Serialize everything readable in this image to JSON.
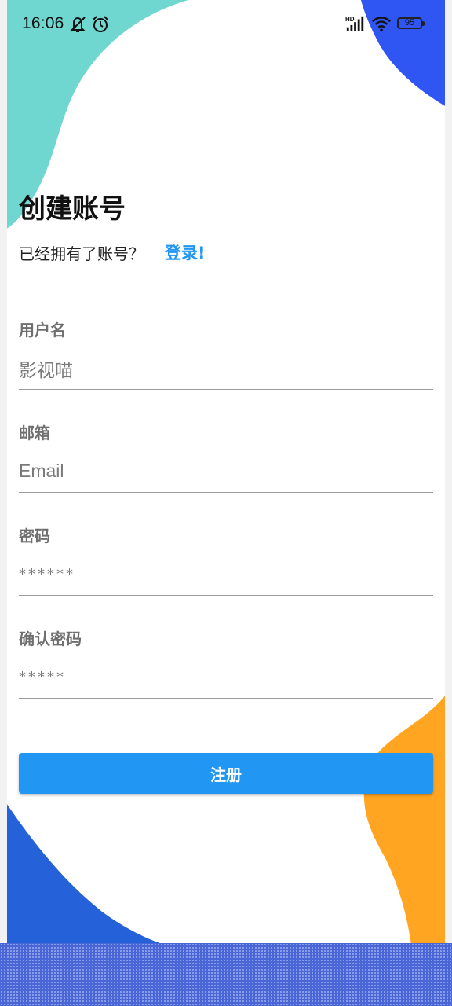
{
  "status_bar": {
    "time": "16:06",
    "network_badge": "HD",
    "battery": "95",
    "icons": [
      "mute-icon",
      "alarm-icon",
      "signal-icon",
      "wifi-icon",
      "battery-icon"
    ]
  },
  "header": {
    "title": "创建账号",
    "subtitle": "已经拥有了账号？",
    "login_link": "登录!"
  },
  "form": {
    "username": {
      "label": "用户名",
      "value": "影视喵"
    },
    "email": {
      "label": "邮箱",
      "placeholder": "Email"
    },
    "password": {
      "label": "密码",
      "value": "******"
    },
    "confirm_password": {
      "label": "确认密码",
      "value": "*****"
    },
    "submit_label": "注册"
  },
  "colors": {
    "accent": "#2196f3",
    "teal_shape": "#6fd6d0",
    "blue_shape": "#2f55f2",
    "orange_shape": "#ffa521",
    "bottom_blue_shape": "#2561d8"
  }
}
